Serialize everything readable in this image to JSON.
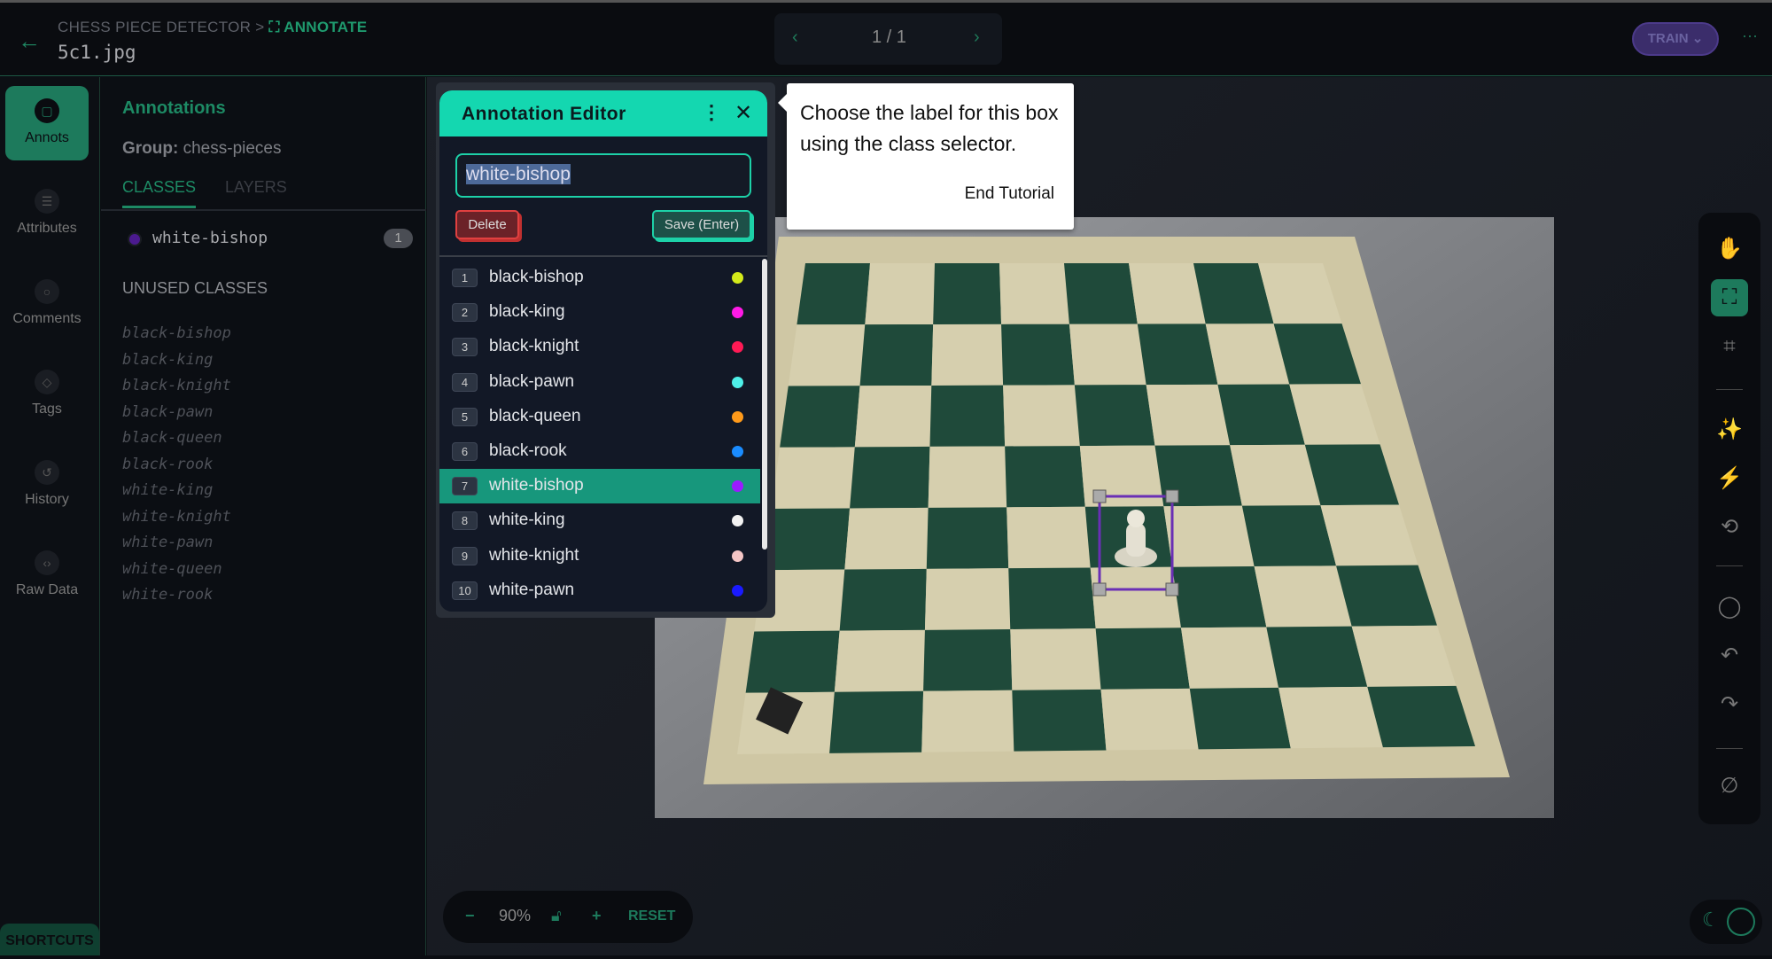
{
  "header": {
    "project": "CHESS PIECE DETECTOR",
    "section": "ANNOTATE",
    "filename": "5c1.jpg",
    "page": "1 / 1",
    "train_label": "TRAIN"
  },
  "nav": {
    "items": [
      {
        "label": "Annots",
        "icon": "annotation-icon"
      },
      {
        "label": "Attributes",
        "icon": "list-icon"
      },
      {
        "label": "Comments",
        "icon": "comment-icon"
      },
      {
        "label": "Tags",
        "icon": "tag-icon"
      },
      {
        "label": "History",
        "icon": "history-icon"
      },
      {
        "label": "Raw Data",
        "icon": "code-icon"
      }
    ],
    "shortcuts": "SHORTCUTS"
  },
  "panel": {
    "title": "Annotations",
    "group_label": "Group:",
    "group": "chess-pieces",
    "tabs": [
      "CLASSES",
      "LAYERS"
    ],
    "used": [
      {
        "name": "white-bishop",
        "count": "1",
        "color": "#4b1a8f"
      }
    ],
    "unused_title": "UNUSED CLASSES",
    "unused": [
      "black-bishop",
      "black-king",
      "black-knight",
      "black-pawn",
      "black-queen",
      "black-rook",
      "white-king",
      "white-knight",
      "white-pawn",
      "white-queen",
      "white-rook"
    ]
  },
  "editor": {
    "title": "Annotation Editor",
    "input_value": "white-bishop",
    "delete": "Delete",
    "save": "Save (Enter)",
    "options": [
      {
        "n": "1",
        "name": "black-bishop",
        "color": "#d4ea1a"
      },
      {
        "n": "2",
        "name": "black-king",
        "color": "#ff1ae6"
      },
      {
        "n": "3",
        "name": "black-knight",
        "color": "#ff1a55"
      },
      {
        "n": "4",
        "name": "black-pawn",
        "color": "#4ef0e8"
      },
      {
        "n": "5",
        "name": "black-queen",
        "color": "#ff9a1a"
      },
      {
        "n": "6",
        "name": "black-rook",
        "color": "#1a8cff"
      },
      {
        "n": "7",
        "name": "white-bishop",
        "color": "#9b1aff",
        "selected": true
      },
      {
        "n": "8",
        "name": "white-king",
        "color": "#f2f2f2"
      },
      {
        "n": "9",
        "name": "white-knight",
        "color": "#f5c6c6"
      },
      {
        "n": "10",
        "name": "white-pawn",
        "color": "#1a1aff"
      }
    ]
  },
  "tooltip": {
    "text": "Choose the label for this box using the class selector.",
    "end": "End Tutorial"
  },
  "zoom": {
    "minus": "−",
    "value": "90%",
    "plus": "+",
    "reset": "RESET"
  },
  "colors": {
    "accent": "#1d7a5c",
    "editor_header": "#14d7b0",
    "box": "#6a2fb5"
  }
}
